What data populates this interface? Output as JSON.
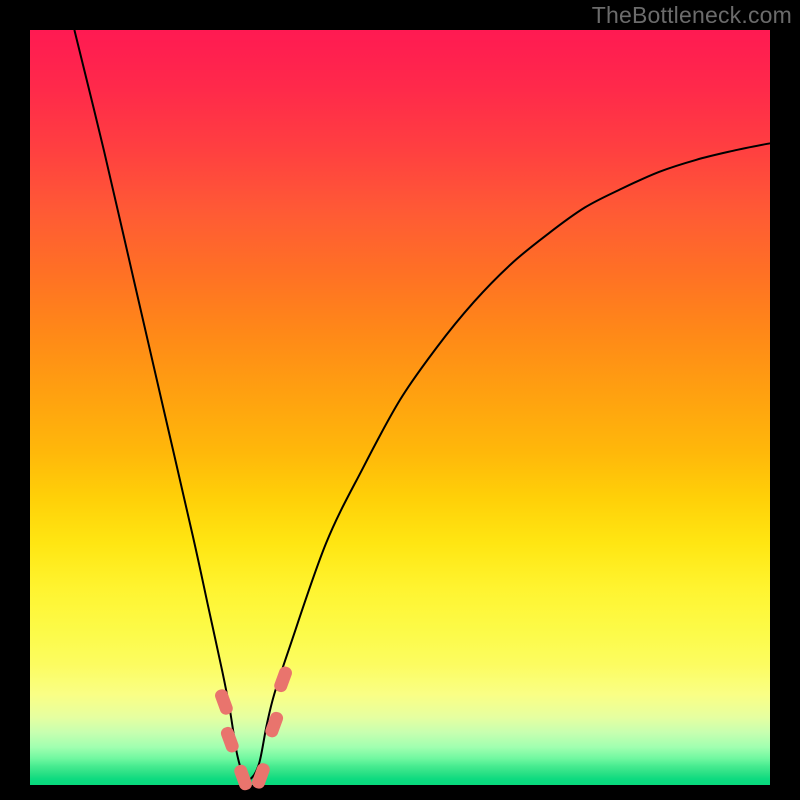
{
  "watermark": "TheBottleneck.com",
  "colors": {
    "page_bg": "#000000",
    "curve_stroke": "#000000",
    "marker_fill": "#e9746d",
    "gradient_top": "#ff1a52",
    "gradient_bottom": "#08d87c"
  },
  "chart_data": {
    "type": "line",
    "title": "",
    "xlabel": "",
    "ylabel": "",
    "xlim": [
      0,
      100
    ],
    "ylim": [
      0,
      100
    ],
    "grid": false,
    "description": "Bottleneck-style V-curve. y ≈ 100 is worst (red), y ≈ 0 is best (green). Minimum near x ≈ 29.",
    "series": [
      {
        "name": "bottleneck-curve",
        "x": [
          6,
          10,
          14,
          18,
          22,
          24,
          26,
          27,
          28,
          29,
          30,
          31,
          32,
          33,
          35,
          40,
          45,
          50,
          55,
          60,
          65,
          70,
          75,
          80,
          85,
          90,
          95,
          100
        ],
        "y": [
          100,
          84,
          67,
          50,
          33,
          24,
          15,
          10,
          4,
          1,
          1,
          3,
          8,
          12,
          18,
          32,
          42,
          51,
          58,
          64,
          69,
          73,
          76.5,
          79,
          81.2,
          82.8,
          84,
          85
        ]
      }
    ],
    "annotations": {
      "markers_near_minimum": [
        {
          "x": 26.2,
          "y": 11,
          "shape": "rounded-rect"
        },
        {
          "x": 27.0,
          "y": 6,
          "shape": "rounded-rect"
        },
        {
          "x": 28.8,
          "y": 1,
          "shape": "rounded-rect"
        },
        {
          "x": 31.2,
          "y": 1.2,
          "shape": "rounded-rect"
        },
        {
          "x": 33.0,
          "y": 8,
          "shape": "rounded-rect"
        },
        {
          "x": 34.2,
          "y": 14,
          "shape": "rounded-rect"
        }
      ]
    }
  }
}
